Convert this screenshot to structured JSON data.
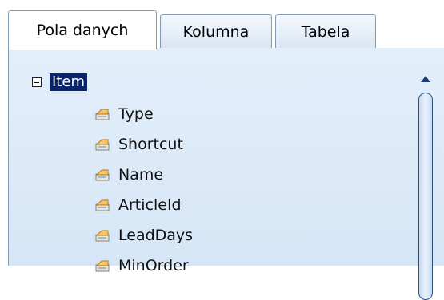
{
  "tabs": [
    {
      "label": "Pola danych",
      "active": true
    },
    {
      "label": "Kolumna",
      "active": false
    },
    {
      "label": "Tabela",
      "active": false
    }
  ],
  "tree": {
    "root": {
      "label": "Item",
      "expanded": true,
      "selected": true,
      "expander_icon": "collapse-icon"
    },
    "children": [
      {
        "label": "Type",
        "icon": "field-icon"
      },
      {
        "label": "Shortcut",
        "icon": "field-icon"
      },
      {
        "label": "Name",
        "icon": "field-icon"
      },
      {
        "label": "ArticleId",
        "icon": "field-icon"
      },
      {
        "label": "LeadDays",
        "icon": "field-icon"
      },
      {
        "label": "MinOrder",
        "icon": "field-icon"
      }
    ]
  },
  "scrollbar": {
    "up_icon": "scroll-up-arrow-icon"
  },
  "colors": {
    "selection_bg": "#0a246a",
    "panel_bg": "#dbe8f6",
    "border": "#7f9db9"
  }
}
